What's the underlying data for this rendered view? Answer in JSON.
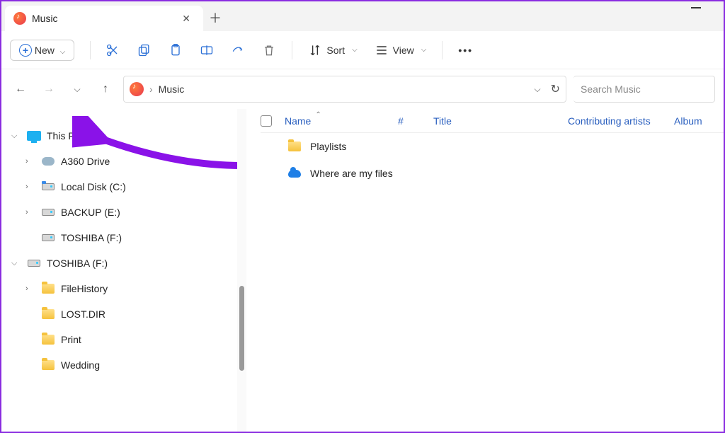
{
  "tab": {
    "title": "Music"
  },
  "toolbar": {
    "new_label": "New",
    "sort_label": "Sort",
    "view_label": "View"
  },
  "nav": {
    "breadcrumb": "Music",
    "search_placeholder": "Search Music"
  },
  "columns": {
    "name": "Name",
    "number": "#",
    "title": "Title",
    "contributing": "Contributing artists",
    "album": "Album"
  },
  "files": [
    {
      "name": "Playlists",
      "kind": "folder"
    },
    {
      "name": "Where are my files",
      "kind": "cloud"
    }
  ],
  "tree": {
    "thispc": "This PC",
    "a360": "A360 Drive",
    "localc": "Local Disk (C:)",
    "backup": "BACKUP (E:)",
    "toshiba1": "TOSHIBA (F:)",
    "toshiba2": "TOSHIBA (F:)",
    "filehistory": "FileHistory",
    "lostdir": "LOST.DIR",
    "print": "Print",
    "wedding": "Wedding"
  }
}
